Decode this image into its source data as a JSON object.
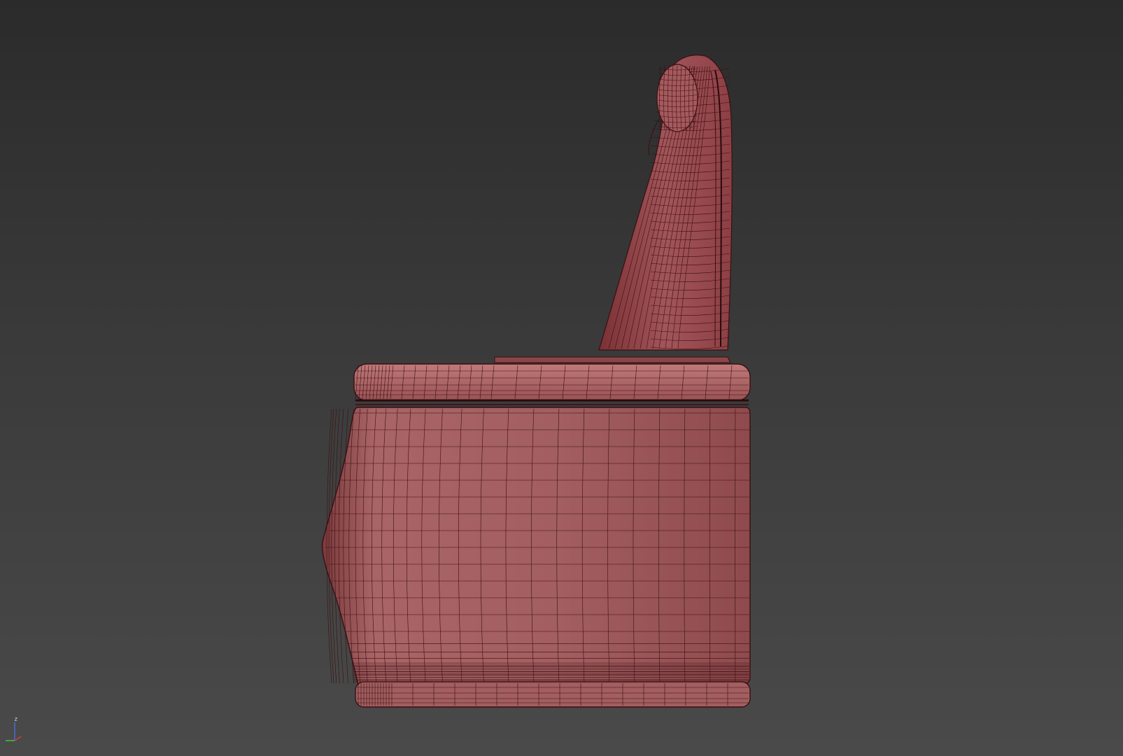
{
  "viewport": {
    "background_top": "#2b2b2b",
    "background_bottom": "#4a4a4a",
    "shading": "wireframe-on-shaded"
  },
  "model": {
    "object": "recliner-chair",
    "view": "side",
    "surface_color": "#a05a5c",
    "surface_highlight": "#b57472",
    "surface_shadow": "#6e2e30",
    "wire_color": "#3a0f12"
  },
  "axis_gizmo": {
    "z_label": "z",
    "x_color": "#d23c3c",
    "y_color": "#3cc83c",
    "z_color": "#4a6ad8"
  }
}
